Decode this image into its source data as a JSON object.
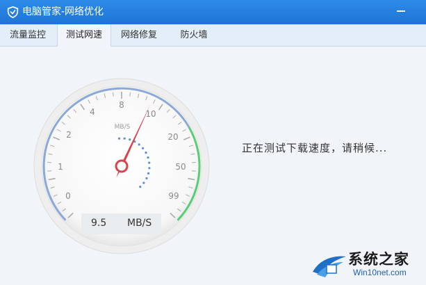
{
  "window": {
    "title": "电脑管家-网络优化"
  },
  "tabs": [
    {
      "label": "流量监控",
      "active": false
    },
    {
      "label": "测试网速",
      "active": true
    },
    {
      "label": "网络修复",
      "active": false
    },
    {
      "label": "防火墙",
      "active": false
    }
  ],
  "gauge": {
    "unit_label": "MB/S",
    "ticks": [
      "0",
      "1",
      "2",
      "4",
      "8",
      "10",
      "20",
      "50",
      "99"
    ]
  },
  "speed": {
    "value": "9.5",
    "unit": "MB/S"
  },
  "status": {
    "message": "正在测试下载速度，请稍候..."
  },
  "watermark": {
    "title": "系统之家",
    "site": "Win10net.com"
  },
  "colors": {
    "titlebar": "#1e75d6",
    "arc_blue": "#8aa9d8",
    "arc_green": "#59cc76",
    "needle": "#d9434b"
  }
}
